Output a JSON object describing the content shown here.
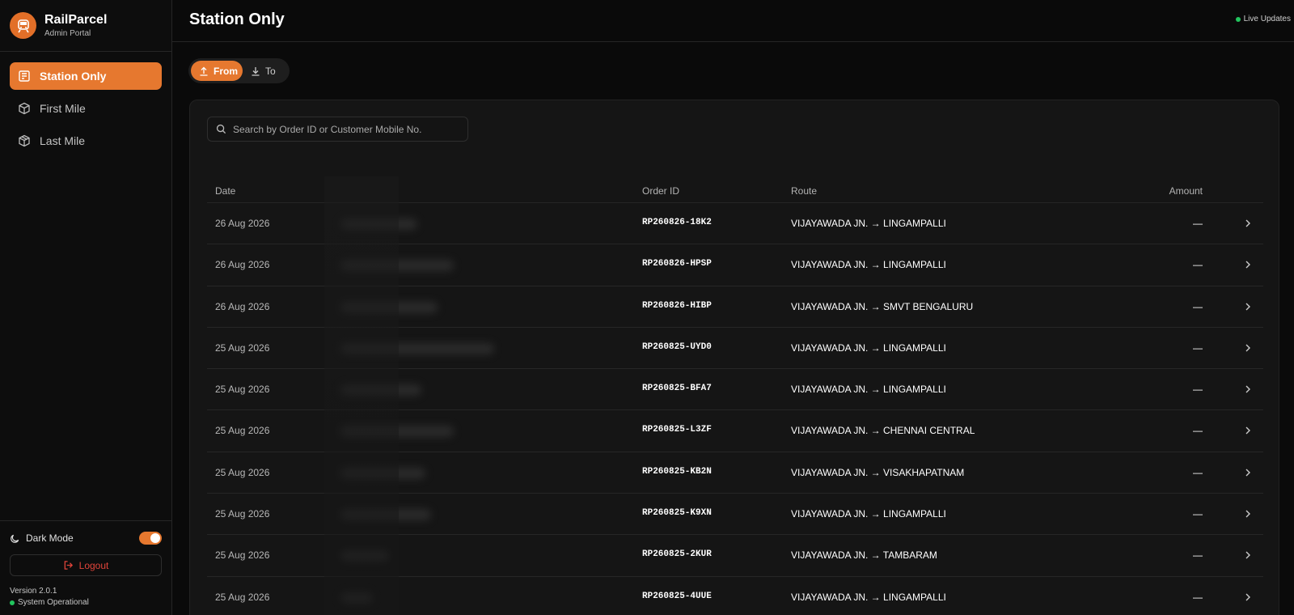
{
  "app": {
    "name": "RailParcel",
    "subtitle": "Admin Portal"
  },
  "colors": {
    "accent": "#e6782f",
    "danger": "#e0443a",
    "success": "#22c55e",
    "background": "#0a0a0a",
    "card": "#151515"
  },
  "sidebar": {
    "items": [
      {
        "label": "Station Only",
        "icon": "station-icon",
        "active": true
      },
      {
        "label": "First Mile",
        "icon": "package-icon",
        "active": false
      },
      {
        "label": "Last Mile",
        "icon": "box-icon",
        "active": false
      }
    ],
    "dark_mode_label": "Dark Mode",
    "dark_mode_on": true,
    "logout_label": "Logout",
    "version": "Version 2.0.1",
    "system_status": "System Operational"
  },
  "header": {
    "title": "Station Only",
    "live_label": "Live Updates"
  },
  "direction": {
    "from_label": "From",
    "to_label": "To",
    "selected": "From"
  },
  "search": {
    "placeholder": "Search by Order ID or Customer Mobile No."
  },
  "table": {
    "columns": {
      "date": "Date",
      "order_id": "Order ID",
      "route": "Route",
      "amount": "Amount"
    },
    "rows": [
      {
        "date": "26 Aug 2026",
        "order_id": "RP260826-18K2",
        "route": "VIJAYAWADA JN. → LINGAMPALLI",
        "amount": "—"
      },
      {
        "date": "26 Aug 2026",
        "order_id": "RP260826-HPSP",
        "route": "VIJAYAWADA JN. → LINGAMPALLI",
        "amount": "—"
      },
      {
        "date": "26 Aug 2026",
        "order_id": "RP260826-HIBP",
        "route": "VIJAYAWADA JN. → SMVT BENGALURU",
        "amount": "—"
      },
      {
        "date": "25 Aug 2026",
        "order_id": "RP260825-UYD0",
        "route": "VIJAYAWADA JN. → LINGAMPALLI",
        "amount": "—"
      },
      {
        "date": "25 Aug 2026",
        "order_id": "RP260825-BFA7",
        "route": "VIJAYAWADA JN. → LINGAMPALLI",
        "amount": "—"
      },
      {
        "date": "25 Aug 2026",
        "order_id": "RP260825-L3ZF",
        "route": "VIJAYAWADA JN. → CHENNAI CENTRAL",
        "amount": "—"
      },
      {
        "date": "25 Aug 2026",
        "order_id": "RP260825-KB2N",
        "route": "VIJAYAWADA JN. → VISAKHAPATNAM",
        "amount": "—"
      },
      {
        "date": "25 Aug 2026",
        "order_id": "RP260825-K9XN",
        "route": "VIJAYAWADA JN. → LINGAMPALLI",
        "amount": "—"
      },
      {
        "date": "25 Aug 2026",
        "order_id": "RP260825-2KUR",
        "route": "VIJAYAWADA JN. → TAMBARAM",
        "amount": "—"
      },
      {
        "date": "25 Aug 2026",
        "order_id": "RP260825-4UUE",
        "route": "VIJAYAWADA JN. → LINGAMPALLI",
        "amount": "—"
      }
    ]
  }
}
